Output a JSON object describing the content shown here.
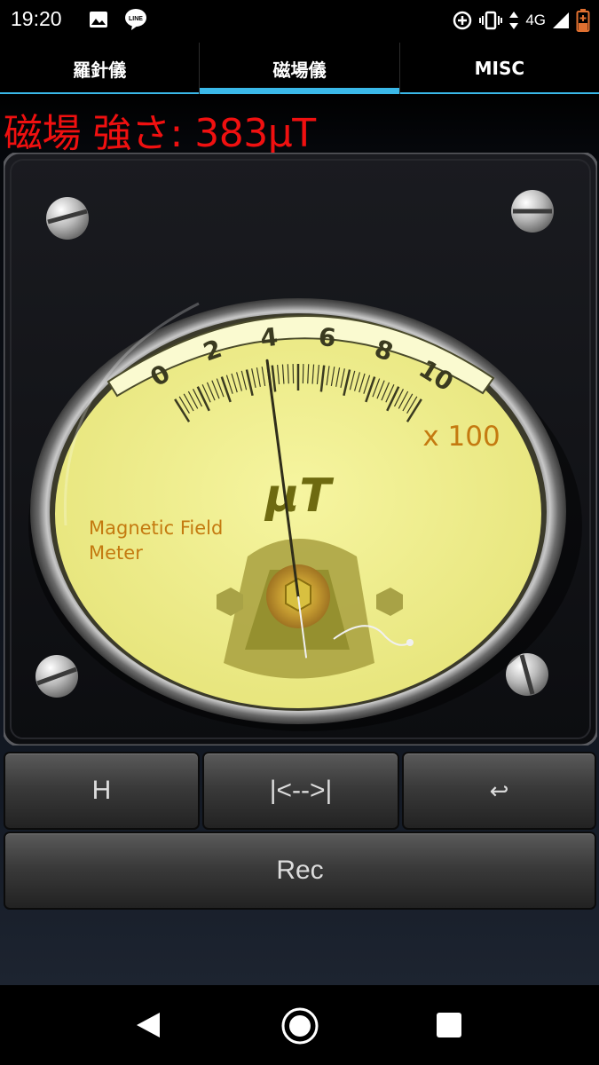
{
  "status_bar": {
    "time": "19:20",
    "network": "4G",
    "icons": [
      "image-icon",
      "line-app-icon",
      "data-saver-icon",
      "vibrate-icon",
      "data-arrows-icon",
      "signal-icon",
      "battery-icon"
    ]
  },
  "tabs": [
    {
      "label": "羅針儀",
      "active": false
    },
    {
      "label": "磁場儀",
      "active": true
    },
    {
      "label": "MISC",
      "active": false
    }
  ],
  "readout": {
    "label": "磁場 強さ: ",
    "value": "383μT",
    "color": "#f01010"
  },
  "meter": {
    "scale_labels": [
      "0",
      "2",
      "4",
      "6",
      "8",
      "10"
    ],
    "scale_min": 0,
    "scale_max": 10,
    "needle_value": 3.83,
    "multiplier": "x 100",
    "unit": "μT",
    "caption_line1": "Magnetic Field",
    "caption_line2": "Meter",
    "face_color": "#f1f08c",
    "label_color": "#c47a10"
  },
  "buttons": {
    "h": "H",
    "range": "|<-->|",
    "return": "↩",
    "rec": "Rec"
  },
  "accent_color": "#3ab8e8"
}
